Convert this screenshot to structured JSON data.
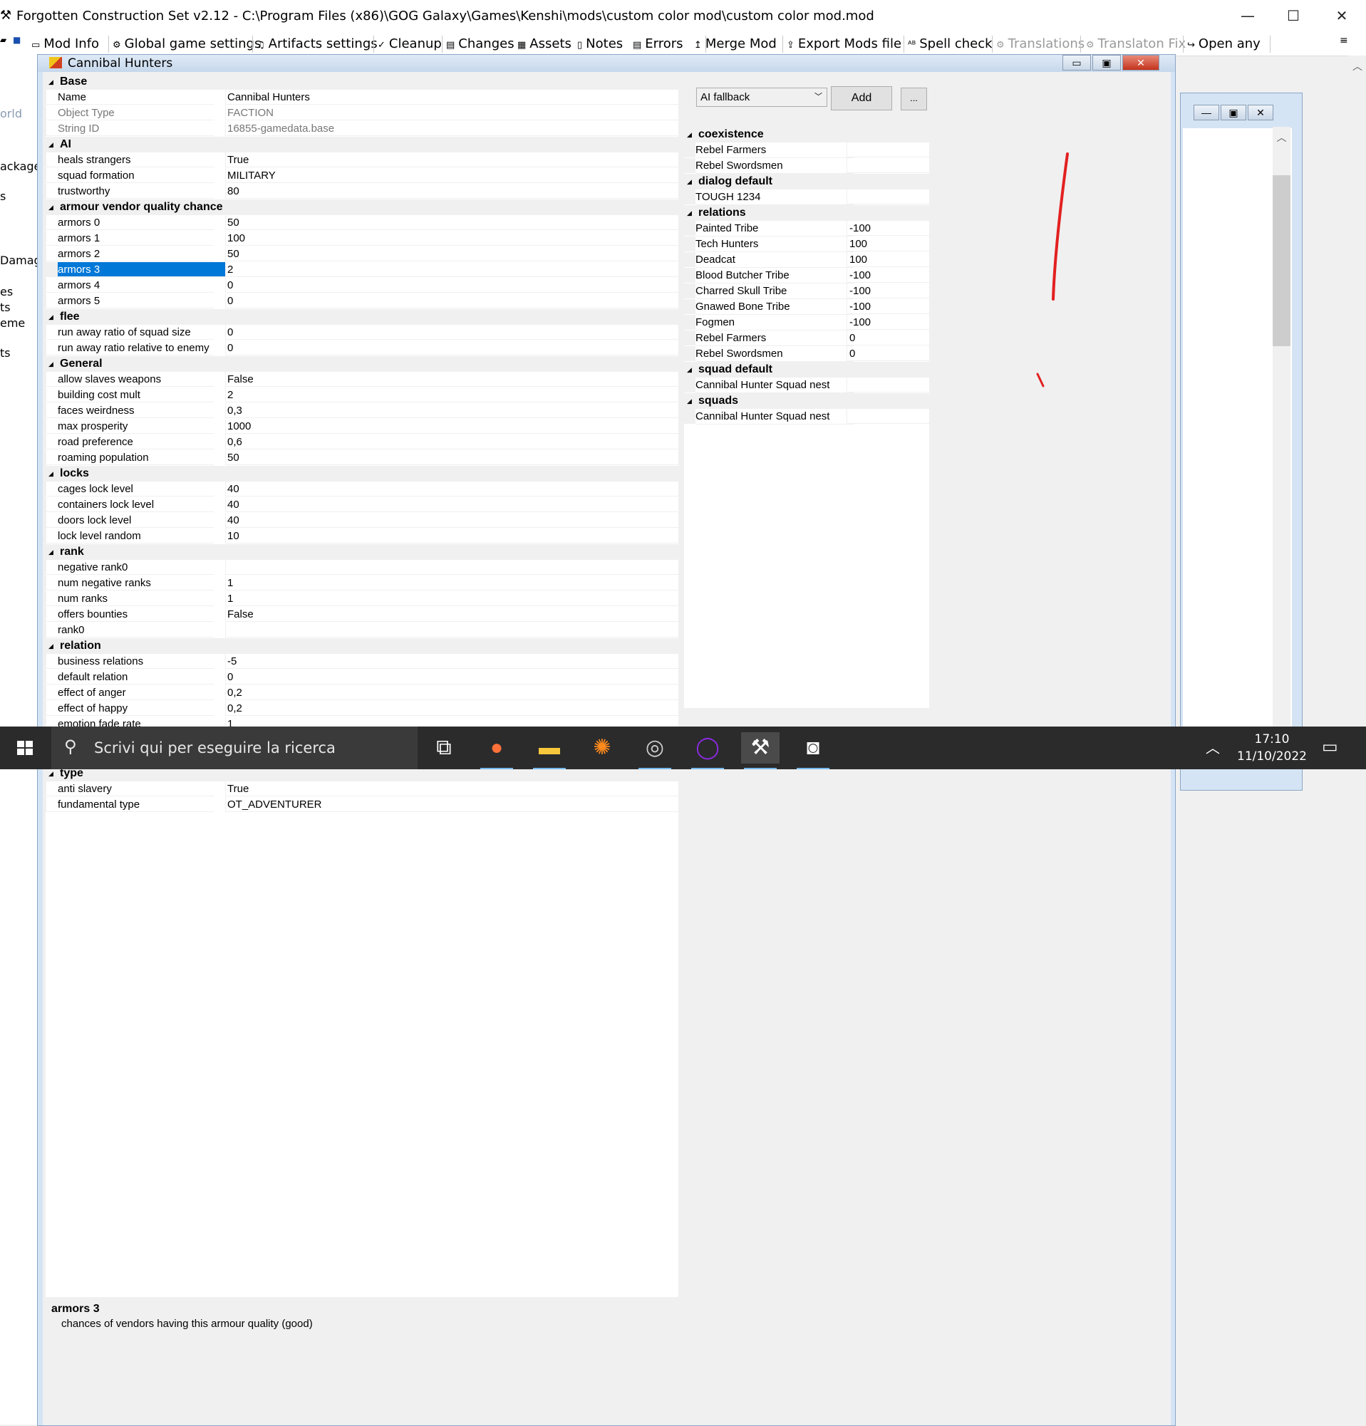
{
  "window": {
    "title": "Forgotten Construction Set v2.12 - C:\\Program Files (x86)\\GOG Galaxy\\Games\\Kenshi\\mods\\custom color mod\\custom color mod.mod"
  },
  "menu": [
    {
      "label": "Mod Info",
      "icon": "info-icon",
      "glyph": "▭",
      "disabled": false
    },
    {
      "label": "Global game settings",
      "icon": "gear-icon",
      "glyph": "⚙",
      "disabled": false
    },
    {
      "label": "Artifacts settings",
      "icon": "artifact-icon",
      "glyph": "♫",
      "disabled": false
    },
    {
      "label": "Cleanup",
      "icon": "check-icon",
      "glyph": "✓",
      "disabled": false
    },
    {
      "label": "Changes",
      "icon": "changes-icon",
      "glyph": "▤",
      "disabled": false
    },
    {
      "label": "Assets",
      "icon": "assets-icon",
      "glyph": "▦",
      "disabled": false
    },
    {
      "label": "Notes",
      "icon": "notes-icon",
      "glyph": "▯",
      "disabled": false
    },
    {
      "label": "Errors",
      "icon": "errors-icon",
      "glyph": "▤",
      "disabled": false
    },
    {
      "label": "Merge Mod",
      "icon": "merge-icon",
      "glyph": "↥",
      "disabled": false
    },
    {
      "label": "Export Mods file",
      "icon": "export-icon",
      "glyph": "⇪",
      "disabled": false
    },
    {
      "label": "Spell check",
      "icon": "spellcheck-icon",
      "glyph": "ᴬᴮ",
      "disabled": false
    },
    {
      "label": "Translations",
      "icon": "translations-icon",
      "glyph": "⚙",
      "disabled": true
    },
    {
      "label": "Translaton Fix",
      "icon": "translation-fix-icon",
      "glyph": "⚙",
      "disabled": true
    },
    {
      "label": "Open any",
      "icon": "open-icon",
      "glyph": "↪",
      "disabled": false
    }
  ],
  "left_labels": [
    "orld",
    "ackage",
    "s",
    "Damag",
    "es",
    "ts",
    "eme",
    "ts"
  ],
  "child": {
    "title": "Cannibal Hunters",
    "min": "▭",
    "max": "▣",
    "close": "✕"
  },
  "grid": [
    {
      "cat": "Base"
    },
    {
      "k": "Name",
      "v": "Cannibal Hunters"
    },
    {
      "k": "Object Type",
      "v": "FACTION",
      "gray": true
    },
    {
      "k": "String ID",
      "v": "16855-gamedata.base",
      "gray": true
    },
    {
      "cat": "AI"
    },
    {
      "k": "heals strangers",
      "v": "True"
    },
    {
      "k": "squad formation",
      "v": "MILITARY"
    },
    {
      "k": "trustworthy",
      "v": "80"
    },
    {
      "cat": "armour vendor quality chance"
    },
    {
      "k": "armors 0",
      "v": "50"
    },
    {
      "k": "armors 1",
      "v": "100"
    },
    {
      "k": "armors 2",
      "v": "50"
    },
    {
      "k": "armors 3",
      "v": "2",
      "selected": true
    },
    {
      "k": "armors 4",
      "v": "0"
    },
    {
      "k": "armors 5",
      "v": "0"
    },
    {
      "cat": "flee"
    },
    {
      "k": "run away ratio of squad size",
      "v": "0"
    },
    {
      "k": "run away ratio relative to enemy",
      "v": "0"
    },
    {
      "cat": "General"
    },
    {
      "k": "allow slaves weapons",
      "v": "False"
    },
    {
      "k": "building cost mult",
      "v": "2"
    },
    {
      "k": "faces weirdness",
      "v": "0,3"
    },
    {
      "k": "max prosperity",
      "v": "1000"
    },
    {
      "k": "road preference",
      "v": "0,6"
    },
    {
      "k": "roaming population",
      "v": "50"
    },
    {
      "cat": "locks"
    },
    {
      "k": "cages lock level",
      "v": "40"
    },
    {
      "k": "containers lock level",
      "v": "40"
    },
    {
      "k": "doors lock level",
      "v": "40"
    },
    {
      "k": "lock level random",
      "v": "10"
    },
    {
      "cat": "rank"
    },
    {
      "k": "negative rank0",
      "v": ""
    },
    {
      "k": "num negative ranks",
      "v": "1"
    },
    {
      "k": "num ranks",
      "v": "1"
    },
    {
      "k": "offers bounties",
      "v": "False"
    },
    {
      "k": "rank0",
      "v": ""
    },
    {
      "cat": "relation"
    },
    {
      "k": "business relations",
      "v": "-5"
    },
    {
      "k": "default relation",
      "v": "0"
    },
    {
      "k": "effect of anger",
      "v": "0,2"
    },
    {
      "k": "effect of happy",
      "v": "0,2"
    },
    {
      "k": "emotion fade rate",
      "v": "1"
    }
  ],
  "grid2": [
    {
      "cat": "type"
    },
    {
      "k": "anti slavery",
      "v": "True"
    },
    {
      "k": "fundamental type",
      "v": "OT_ADVENTURER"
    }
  ],
  "right": {
    "select": "AI fallback",
    "add": "Add",
    "more": "...",
    "rows": [
      {
        "cat": "coexistence"
      },
      {
        "k": "Rebel Farmers",
        "v": ""
      },
      {
        "k": "Rebel Swordsmen",
        "v": ""
      },
      {
        "cat": "dialog default"
      },
      {
        "k": "TOUGH 1234",
        "v": ""
      },
      {
        "cat": "relations"
      },
      {
        "k": "Painted Tribe",
        "v": "-100"
      },
      {
        "k": "Tech Hunters",
        "v": "100"
      },
      {
        "k": "Deadcat",
        "v": "100"
      },
      {
        "k": "Blood Butcher Tribe",
        "v": "-100"
      },
      {
        "k": "Charred Skull Tribe",
        "v": "-100"
      },
      {
        "k": "Gnawed Bone Tribe",
        "v": "-100"
      },
      {
        "k": "Fogmen",
        "v": "-100"
      },
      {
        "k": "Rebel Farmers",
        "v": "0"
      },
      {
        "k": "Rebel Swordsmen",
        "v": "0"
      },
      {
        "cat": "squad default"
      },
      {
        "k": "Cannibal Hunter Squad nest",
        "v": ""
      },
      {
        "cat": "squads"
      },
      {
        "k": "Cannibal Hunter Squad nest",
        "v": ""
      }
    ]
  },
  "description": {
    "name": "armors 3",
    "text": "chances of vendors having this armour quality (good)"
  },
  "taskbar": {
    "search_placeholder": "Scrivi qui per eseguire la ricerca",
    "time": "17:10",
    "date": "11/10/2022",
    "apps": [
      {
        "name": "task-view-icon",
        "glyph": "⧉",
        "color": "#ffffff",
        "active": false
      },
      {
        "name": "firefox-icon",
        "glyph": "●",
        "color": "#ff7139",
        "active": true
      },
      {
        "name": "file-explorer-icon",
        "glyph": "▬",
        "color": "#f8c83c",
        "active": true
      },
      {
        "name": "xnview-icon",
        "glyph": "✺",
        "color": "#ff8a1e",
        "active": false
      },
      {
        "name": "app-swirl-icon",
        "glyph": "◎",
        "color": "#cfcfcf",
        "active": true
      },
      {
        "name": "circle-app-icon",
        "glyph": "◯",
        "color": "#8a2be2",
        "active": true
      },
      {
        "name": "kenshi-fcs-icon",
        "glyph": "⚒",
        "color": "#ffffff",
        "active": true
      },
      {
        "name": "app-swirl2-icon",
        "glyph": "◙",
        "color": "#ffffff",
        "active": true
      }
    ]
  },
  "colors": {
    "selection": "#0078d7",
    "taskbar": "#2b2b2b",
    "accent_red": "#e32020"
  }
}
